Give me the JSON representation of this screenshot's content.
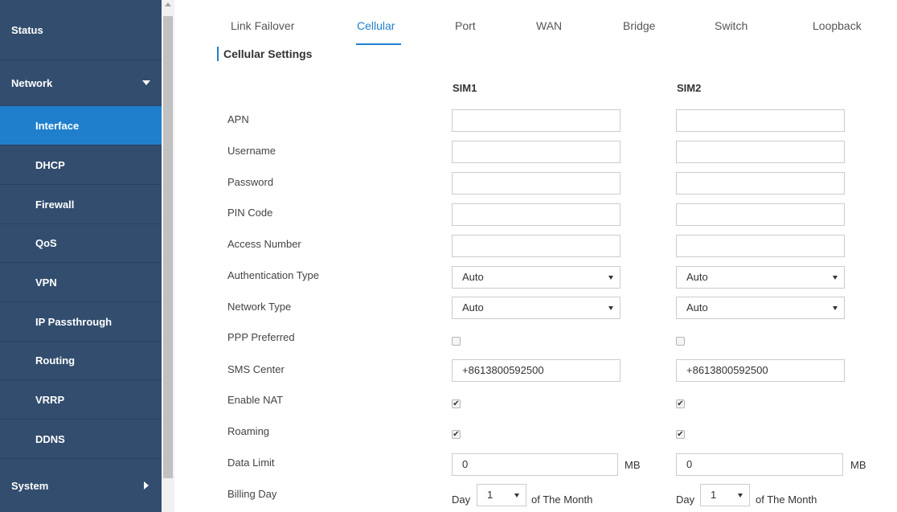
{
  "sidebar": {
    "items": [
      {
        "label": "Status"
      },
      {
        "label": "Network"
      },
      {
        "label": "Interface"
      },
      {
        "label": "DHCP"
      },
      {
        "label": "Firewall"
      },
      {
        "label": "QoS"
      },
      {
        "label": "VPN"
      },
      {
        "label": "IP Passthrough"
      },
      {
        "label": "Routing"
      },
      {
        "label": "VRRP"
      },
      {
        "label": "DDNS"
      },
      {
        "label": "System"
      }
    ]
  },
  "tabs": [
    {
      "label": "Link Failover"
    },
    {
      "label": "Cellular"
    },
    {
      "label": "Port"
    },
    {
      "label": "WAN"
    },
    {
      "label": "Bridge"
    },
    {
      "label": "Switch"
    },
    {
      "label": "Loopback"
    }
  ],
  "section_title": "Cellular Settings",
  "columns": {
    "sim1": "SIM1",
    "sim2": "SIM2"
  },
  "rows": [
    {
      "label": "APN"
    },
    {
      "label": "Username"
    },
    {
      "label": "Password"
    },
    {
      "label": "PIN Code"
    },
    {
      "label": "Access Number"
    },
    {
      "label": "Authentication Type"
    },
    {
      "label": "Network Type"
    },
    {
      "label": "PPP Preferred"
    },
    {
      "label": "SMS Center"
    },
    {
      "label": "Enable NAT"
    },
    {
      "label": "Roaming"
    },
    {
      "label": "Data Limit"
    },
    {
      "label": "Billing Day"
    }
  ],
  "sim1": {
    "auth_type": "Auto",
    "network_type": "Auto",
    "sms_center": "+8613800592500",
    "data_limit": "0",
    "billing_day": "1"
  },
  "sim2": {
    "auth_type": "Auto",
    "network_type": "Auto",
    "sms_center": "+8613800592500",
    "data_limit": "0",
    "billing_day": "1"
  },
  "labels": {
    "mb": "MB",
    "day": "Day",
    "of_month": "of The Month",
    "check": "✔"
  },
  "colors": {
    "sidebar_bg": "#324d6e",
    "active_bg": "#1f7fcd",
    "accent": "#1f7fcd"
  },
  "icons": {
    "network_expand": "chevron-down-icon",
    "system_expand": "chevron-right-icon",
    "select_caret": "caret-down-icon"
  }
}
